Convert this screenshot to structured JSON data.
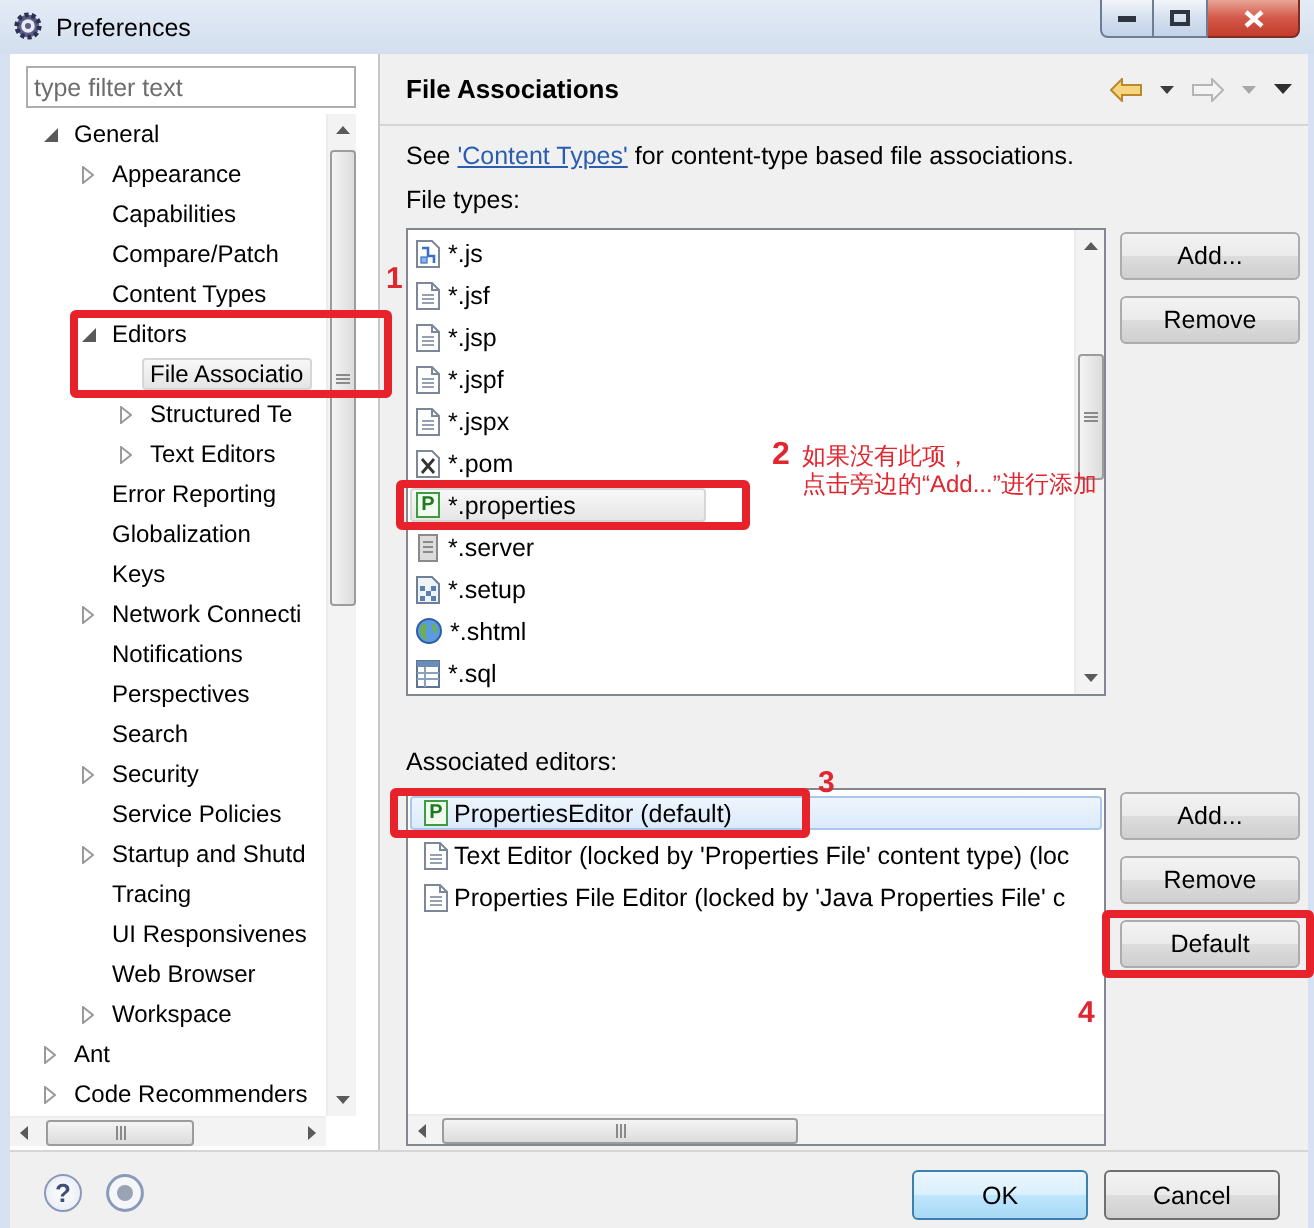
{
  "window": {
    "title": "Preferences"
  },
  "sidebar": {
    "filter": {
      "placeholder": "type filter text"
    },
    "tree": [
      {
        "label": "General",
        "expanded": true,
        "selected": false,
        "children": [
          {
            "label": "Appearance",
            "expanded": false,
            "selected": false
          },
          {
            "label": "Capabilities",
            "selected": false
          },
          {
            "label": "Compare/Patch",
            "selected": false
          },
          {
            "label": "Content Types",
            "selected": false
          },
          {
            "label": "Editors",
            "expanded": true,
            "selected": false,
            "children": [
              {
                "label": "File Associatio",
                "selected": true
              },
              {
                "label": "Structured Te",
                "expanded": false,
                "selected": false
              },
              {
                "label": "Text Editors",
                "expanded": false,
                "selected": false
              }
            ]
          },
          {
            "label": "Error Reporting",
            "selected": false
          },
          {
            "label": "Globalization",
            "selected": false
          },
          {
            "label": "Keys",
            "selected": false
          },
          {
            "label": "Network Connecti",
            "expanded": false,
            "selected": false
          },
          {
            "label": "Notifications",
            "selected": false
          },
          {
            "label": "Perspectives",
            "selected": false
          },
          {
            "label": "Search",
            "selected": false
          },
          {
            "label": "Security",
            "expanded": false,
            "selected": false
          },
          {
            "label": "Service Policies",
            "selected": false
          },
          {
            "label": "Startup and Shutd",
            "expanded": false,
            "selected": false
          },
          {
            "label": "Tracing",
            "selected": false
          },
          {
            "label": "UI Responsivenes",
            "selected": false
          },
          {
            "label": "Web Browser",
            "selected": false
          },
          {
            "label": "Workspace",
            "expanded": false,
            "selected": false
          }
        ]
      },
      {
        "label": "Ant",
        "expanded": false,
        "selected": false
      },
      {
        "label": "Code Recommenders",
        "expanded": false,
        "selected": false
      }
    ]
  },
  "page": {
    "title": "File Associations",
    "nav": [
      {
        "kind": "back",
        "disabled": false
      },
      {
        "kind": "dropdown",
        "disabled": false
      },
      {
        "kind": "forward",
        "disabled": true
      },
      {
        "kind": "dropdown",
        "disabled": true
      },
      {
        "kind": "menu",
        "disabled": false
      }
    ],
    "intro": {
      "before": "See ",
      "link": "'Content Types'",
      "after": " for content-type based file associations."
    },
    "file_types": {
      "label": "File types:",
      "items": [
        {
          "label": "*.js",
          "kind": "script",
          "selected": false
        },
        {
          "label": "*.jsf",
          "kind": "text",
          "selected": false
        },
        {
          "label": "*.jsp",
          "kind": "text",
          "selected": false
        },
        {
          "label": "*.jspf",
          "kind": "text",
          "selected": false
        },
        {
          "label": "*.jspx",
          "kind": "text",
          "selected": false
        },
        {
          "label": "*.pom",
          "kind": "xml",
          "selected": false
        },
        {
          "label": "*.properties",
          "kind": "properties",
          "badge": "P",
          "selected": true
        },
        {
          "label": "*.server",
          "kind": "server",
          "selected": false
        },
        {
          "label": "*.setup",
          "kind": "setup",
          "selected": false
        },
        {
          "label": "*.shtml",
          "kind": "web",
          "selected": false
        },
        {
          "label": "*.sql",
          "kind": "sql",
          "selected": false
        }
      ],
      "buttons": [
        "Add...",
        "Remove"
      ]
    },
    "editors": {
      "label": "Associated editors:",
      "items": [
        {
          "label": "PropertiesEditor (default)",
          "kind": "properties",
          "badge": "P",
          "selected": true
        },
        {
          "label": "Text Editor (locked by 'Properties File' content type) (loc",
          "kind": "text",
          "selected": false
        },
        {
          "label": "Properties File Editor (locked by 'Java Properties File' c",
          "kind": "text",
          "selected": false
        }
      ],
      "buttons": [
        "Add...",
        "Remove",
        "Default"
      ]
    }
  },
  "footer": {
    "help": "?",
    "buttons": [
      {
        "label": "OK",
        "default": true
      },
      {
        "label": "Cancel",
        "default": false
      }
    ]
  },
  "annotations": [
    {
      "number": "1"
    },
    {
      "number": "2",
      "note": [
        "如果没有此项，",
        "点击旁边的“Add...”进行添加"
      ]
    },
    {
      "number": "3"
    },
    {
      "number": "4"
    }
  ]
}
